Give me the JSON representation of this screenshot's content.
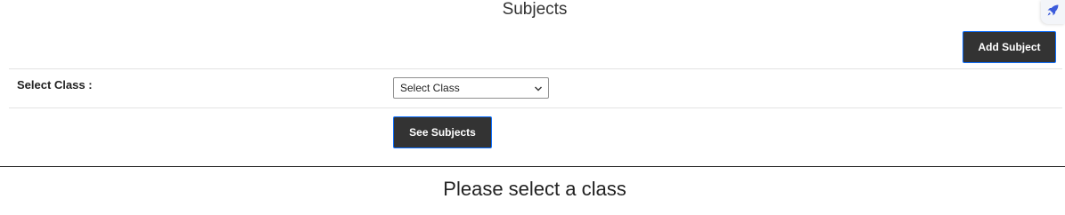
{
  "page": {
    "title": "Subjects"
  },
  "toolbar": {
    "add_subject_label": "Add Subject"
  },
  "filter": {
    "select_class_label": "Select Class :",
    "class_select_value": "Select Class",
    "see_subjects_label": "See Subjects"
  },
  "results": {
    "empty_message": "Please select a class"
  },
  "icons": {
    "floating_tool": "rocket-icon",
    "select_chevron": "chevron-down-icon"
  },
  "colors": {
    "button_bg": "#333333",
    "button_border": "#0d6efd",
    "floating_icon": "#3b5bdb"
  }
}
